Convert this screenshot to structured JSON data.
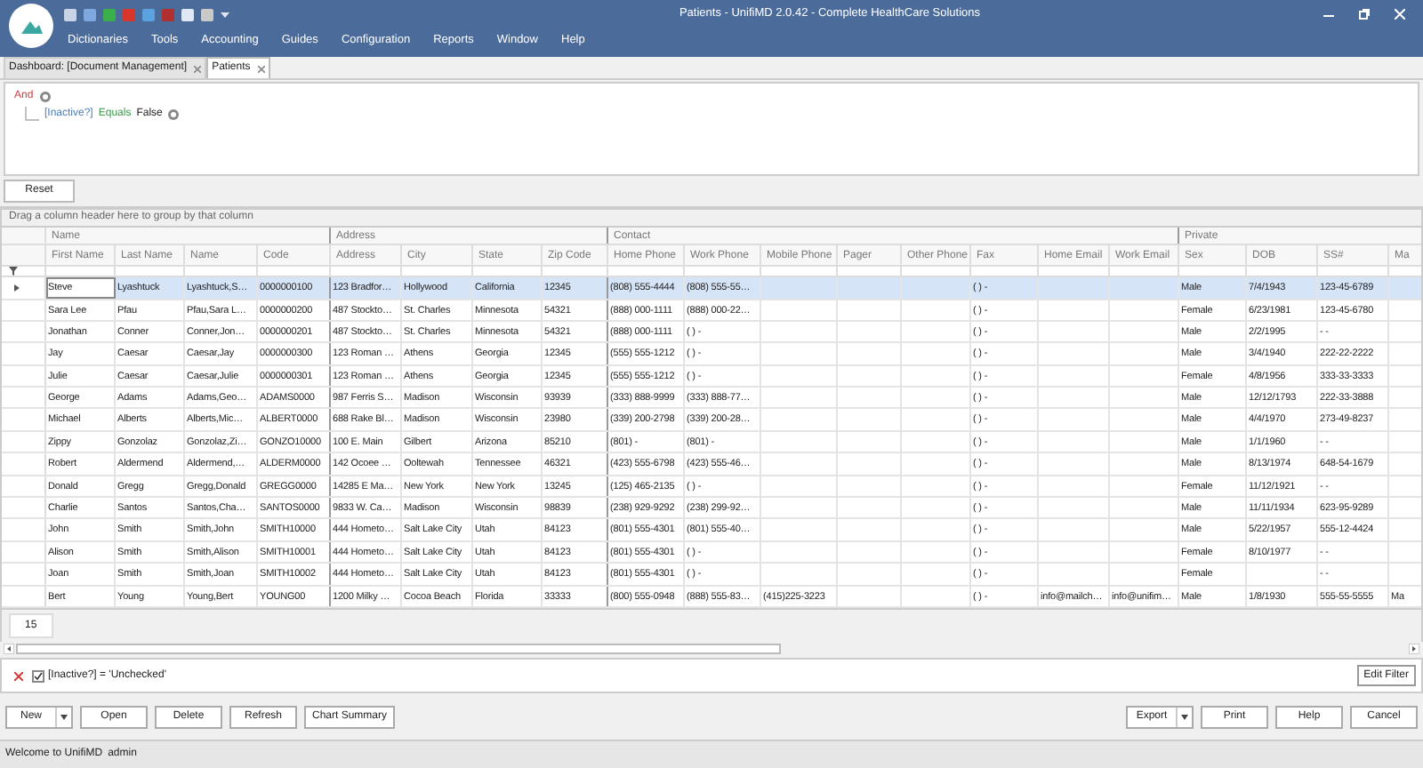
{
  "window": {
    "title": "Patients - UnifiMD 2.0.42 - Complete HealthCare Solutions"
  },
  "menu": [
    "Dictionaries",
    "Tools",
    "Accounting",
    "Guides",
    "Configuration",
    "Reports",
    "Window",
    "Help"
  ],
  "tabs": [
    {
      "label": "Dashboard: [Document Management]",
      "selected": false
    },
    {
      "label": "Patients",
      "selected": true
    }
  ],
  "filter_editor": {
    "operator": "And",
    "condition": {
      "field": "[Inactive?]",
      "op": "Equals",
      "value": "False"
    }
  },
  "reset_button": "Reset",
  "group_panel": "Drag a column header here to group by that column",
  "table": {
    "column_groups": [
      {
        "label": "Name",
        "columns": [
          "First Name",
          "Last Name",
          "Name",
          "Code"
        ]
      },
      {
        "label": "Address",
        "columns": [
          "Address",
          "City",
          "State",
          "Zip Code"
        ]
      },
      {
        "label": "Contact",
        "columns": [
          "Home Phone",
          "Work Phone",
          "Mobile Phone",
          "Pager",
          "Other Phone",
          "Fax",
          "Home Email",
          "Work Email"
        ]
      },
      {
        "label": "Private",
        "columns": [
          "Sex",
          "DOB",
          "SS#",
          "Ma"
        ]
      }
    ],
    "rows": [
      {
        "selected": true,
        "current": true,
        "cells": [
          "Steve",
          "Lyashtuck",
          "Lyashtuck,S…",
          "0000000100",
          "123 Bradfor…",
          "Hollywood",
          "California",
          "12345",
          "(808) 555-4444",
          "(808) 555-55…",
          null,
          null,
          null,
          "( )  -",
          null,
          null,
          "Male",
          "7/4/1943",
          "123-45-6789",
          null
        ]
      },
      {
        "selected": false,
        "current": false,
        "cells": [
          "Sara Lee",
          "Pfau",
          "Pfau,Sara L…",
          "0000000200",
          "487 Stockto…",
          "St. Charles",
          "Minnesota",
          "54321",
          "(888) 000-1111",
          "(888) 000-22…",
          null,
          null,
          null,
          "( )  -",
          null,
          null,
          "Female",
          "6/23/1981",
          "123-45-6780",
          null
        ]
      },
      {
        "selected": false,
        "current": false,
        "cells": [
          "Jonathan",
          "Conner",
          "Conner,Jon…",
          "0000000201",
          "487 Stockto…",
          "St. Charles",
          "Minnesota",
          "54321",
          "(888) 000-1111",
          "( )  -",
          null,
          null,
          null,
          "( )  -",
          null,
          null,
          "Male",
          "2/2/1995",
          "- -",
          null
        ]
      },
      {
        "selected": false,
        "current": false,
        "cells": [
          "Jay",
          "Caesar",
          "Caesar,Jay",
          "0000000300",
          "123 Roman …",
          "Athens",
          "Georgia",
          "12345",
          "(555) 555-1212",
          "( )  -",
          null,
          null,
          null,
          "( )  -",
          null,
          null,
          "Male",
          "3/4/1940",
          "222-22-2222",
          null
        ]
      },
      {
        "selected": false,
        "current": false,
        "cells": [
          "Julie",
          "Caesar",
          "Caesar,Julie",
          "0000000301",
          "123 Roman …",
          "Athens",
          "Georgia",
          "12345",
          "(555) 555-1212",
          "( )  -",
          null,
          null,
          null,
          "( )  -",
          null,
          null,
          "Female",
          "4/8/1956",
          "333-33-3333",
          null
        ]
      },
      {
        "selected": false,
        "current": false,
        "cells": [
          "George",
          "Adams",
          "Adams,Geo…",
          "ADAMS0000",
          "987 Ferris S…",
          "Madison",
          "Wisconsin",
          "93939",
          "(333) 888-9999",
          "(333) 888-77…",
          null,
          null,
          null,
          "( )  -",
          null,
          null,
          "Male",
          "12/12/1793",
          "222-33-3888",
          null
        ]
      },
      {
        "selected": false,
        "current": false,
        "cells": [
          "Michael",
          "Alberts",
          "Alberts,Mic…",
          "ALBERT0000",
          "688 Rake Bl…",
          "Madison",
          "Wisconsin",
          "23980",
          "(339) 200-2798",
          "(339) 200-28…",
          null,
          null,
          null,
          "( )  -",
          null,
          null,
          "Male",
          "4/4/1970",
          "273-49-8237",
          null
        ]
      },
      {
        "selected": false,
        "current": false,
        "cells": [
          "Zippy",
          "Gonzolaz",
          "Gonzolaz,Zi…",
          "GONZO10000",
          "100 E. Main",
          "Gilbert",
          "Arizona",
          "85210",
          "(801)  -",
          "(801)  -",
          null,
          null,
          null,
          "( )  -",
          null,
          null,
          "Male",
          "1/1/1960",
          "- -",
          null
        ]
      },
      {
        "selected": false,
        "current": false,
        "cells": [
          "Robert",
          "Aldermend",
          "Aldermend,…",
          "ALDERM0000",
          "142 Ocoee …",
          "Ooltewah",
          "Tennessee",
          "46321",
          "(423) 555-6798",
          "(423) 555-46…",
          null,
          null,
          null,
          "( )  -",
          null,
          null,
          "Male",
          "8/13/1974",
          "648-54-1679",
          null
        ]
      },
      {
        "selected": false,
        "current": false,
        "cells": [
          "Donald",
          "Gregg",
          "Gregg,Donald",
          "GREGG0000",
          "14285 E Ma…",
          "New York",
          "New York",
          "13245",
          "(125) 465-2135",
          "( )  -",
          null,
          null,
          null,
          "( )  -",
          null,
          null,
          "Female",
          "11/12/1921",
          "- -",
          null
        ]
      },
      {
        "selected": false,
        "current": false,
        "cells": [
          "Charlie",
          "Santos",
          "Santos,Cha…",
          "SANTOS0000",
          "9833 W. Ca…",
          "Madison",
          "Wisconsin",
          "98839",
          "(238) 929-9292",
          "(238) 299-92…",
          null,
          null,
          null,
          "( )  -",
          null,
          null,
          "Male",
          "11/11/1934",
          "623-95-9289",
          null
        ]
      },
      {
        "selected": false,
        "current": false,
        "cells": [
          "John",
          "Smith",
          "Smith,John",
          "SMITH10000",
          "444 Hometo…",
          "Salt Lake City",
          "Utah",
          "84123",
          "(801) 555-4301",
          "(801) 555-40…",
          null,
          null,
          null,
          "( )  -",
          null,
          null,
          "Male",
          "5/22/1957",
          "555-12-4424",
          null
        ]
      },
      {
        "selected": false,
        "current": false,
        "cells": [
          "Alison",
          "Smith",
          "Smith,Alison",
          "SMITH10001",
          "444 Hometo…",
          "Salt Lake City",
          "Utah",
          "84123",
          "(801) 555-4301",
          "( )  -",
          null,
          null,
          null,
          "( )  -",
          null,
          null,
          "Female",
          "8/10/1977",
          "- -",
          null
        ]
      },
      {
        "selected": false,
        "current": false,
        "cells": [
          "Joan",
          "Smith",
          "Smith,Joan",
          "SMITH10002",
          "444 Hometo…",
          "Salt Lake City",
          "Utah",
          "84123",
          "(801) 555-4301",
          "( )  -",
          null,
          null,
          null,
          "( )  -",
          null,
          null,
          "Female",
          null,
          "- -",
          null
        ]
      },
      {
        "selected": false,
        "current": false,
        "cells": [
          "Bert",
          "Young",
          "Young,Bert",
          "YOUNG00",
          "1200 Milky …",
          "Cocoa Beach",
          "Florida",
          "33333",
          "(800) 555-0948",
          "(888) 555-83…",
          "(415)225-3223",
          null,
          null,
          "( )  -",
          "info@mailch…",
          "info@unifim…",
          "Male",
          "1/8/1930",
          "555-55-5555",
          "Ma"
        ]
      }
    ],
    "row_count": "15"
  },
  "active_filter": {
    "enabled": true,
    "text": "[Inactive?] = 'Unchecked'",
    "edit_button": "Edit Filter"
  },
  "buttons_left": [
    {
      "label": "New",
      "kind": "split"
    },
    {
      "label": "Open",
      "kind": "plain"
    },
    {
      "label": "Delete",
      "kind": "plain"
    },
    {
      "label": "Refresh",
      "kind": "plain"
    },
    {
      "label": "Chart Summary",
      "kind": "plain"
    }
  ],
  "buttons_right": [
    {
      "label": "Export",
      "kind": "split"
    },
    {
      "label": "Print",
      "kind": "plain"
    },
    {
      "label": "Help",
      "kind": "plain"
    },
    {
      "label": "Cancel",
      "kind": "plain"
    }
  ],
  "status_bar": [
    "Welcome to UnifiMD",
    "admin"
  ]
}
